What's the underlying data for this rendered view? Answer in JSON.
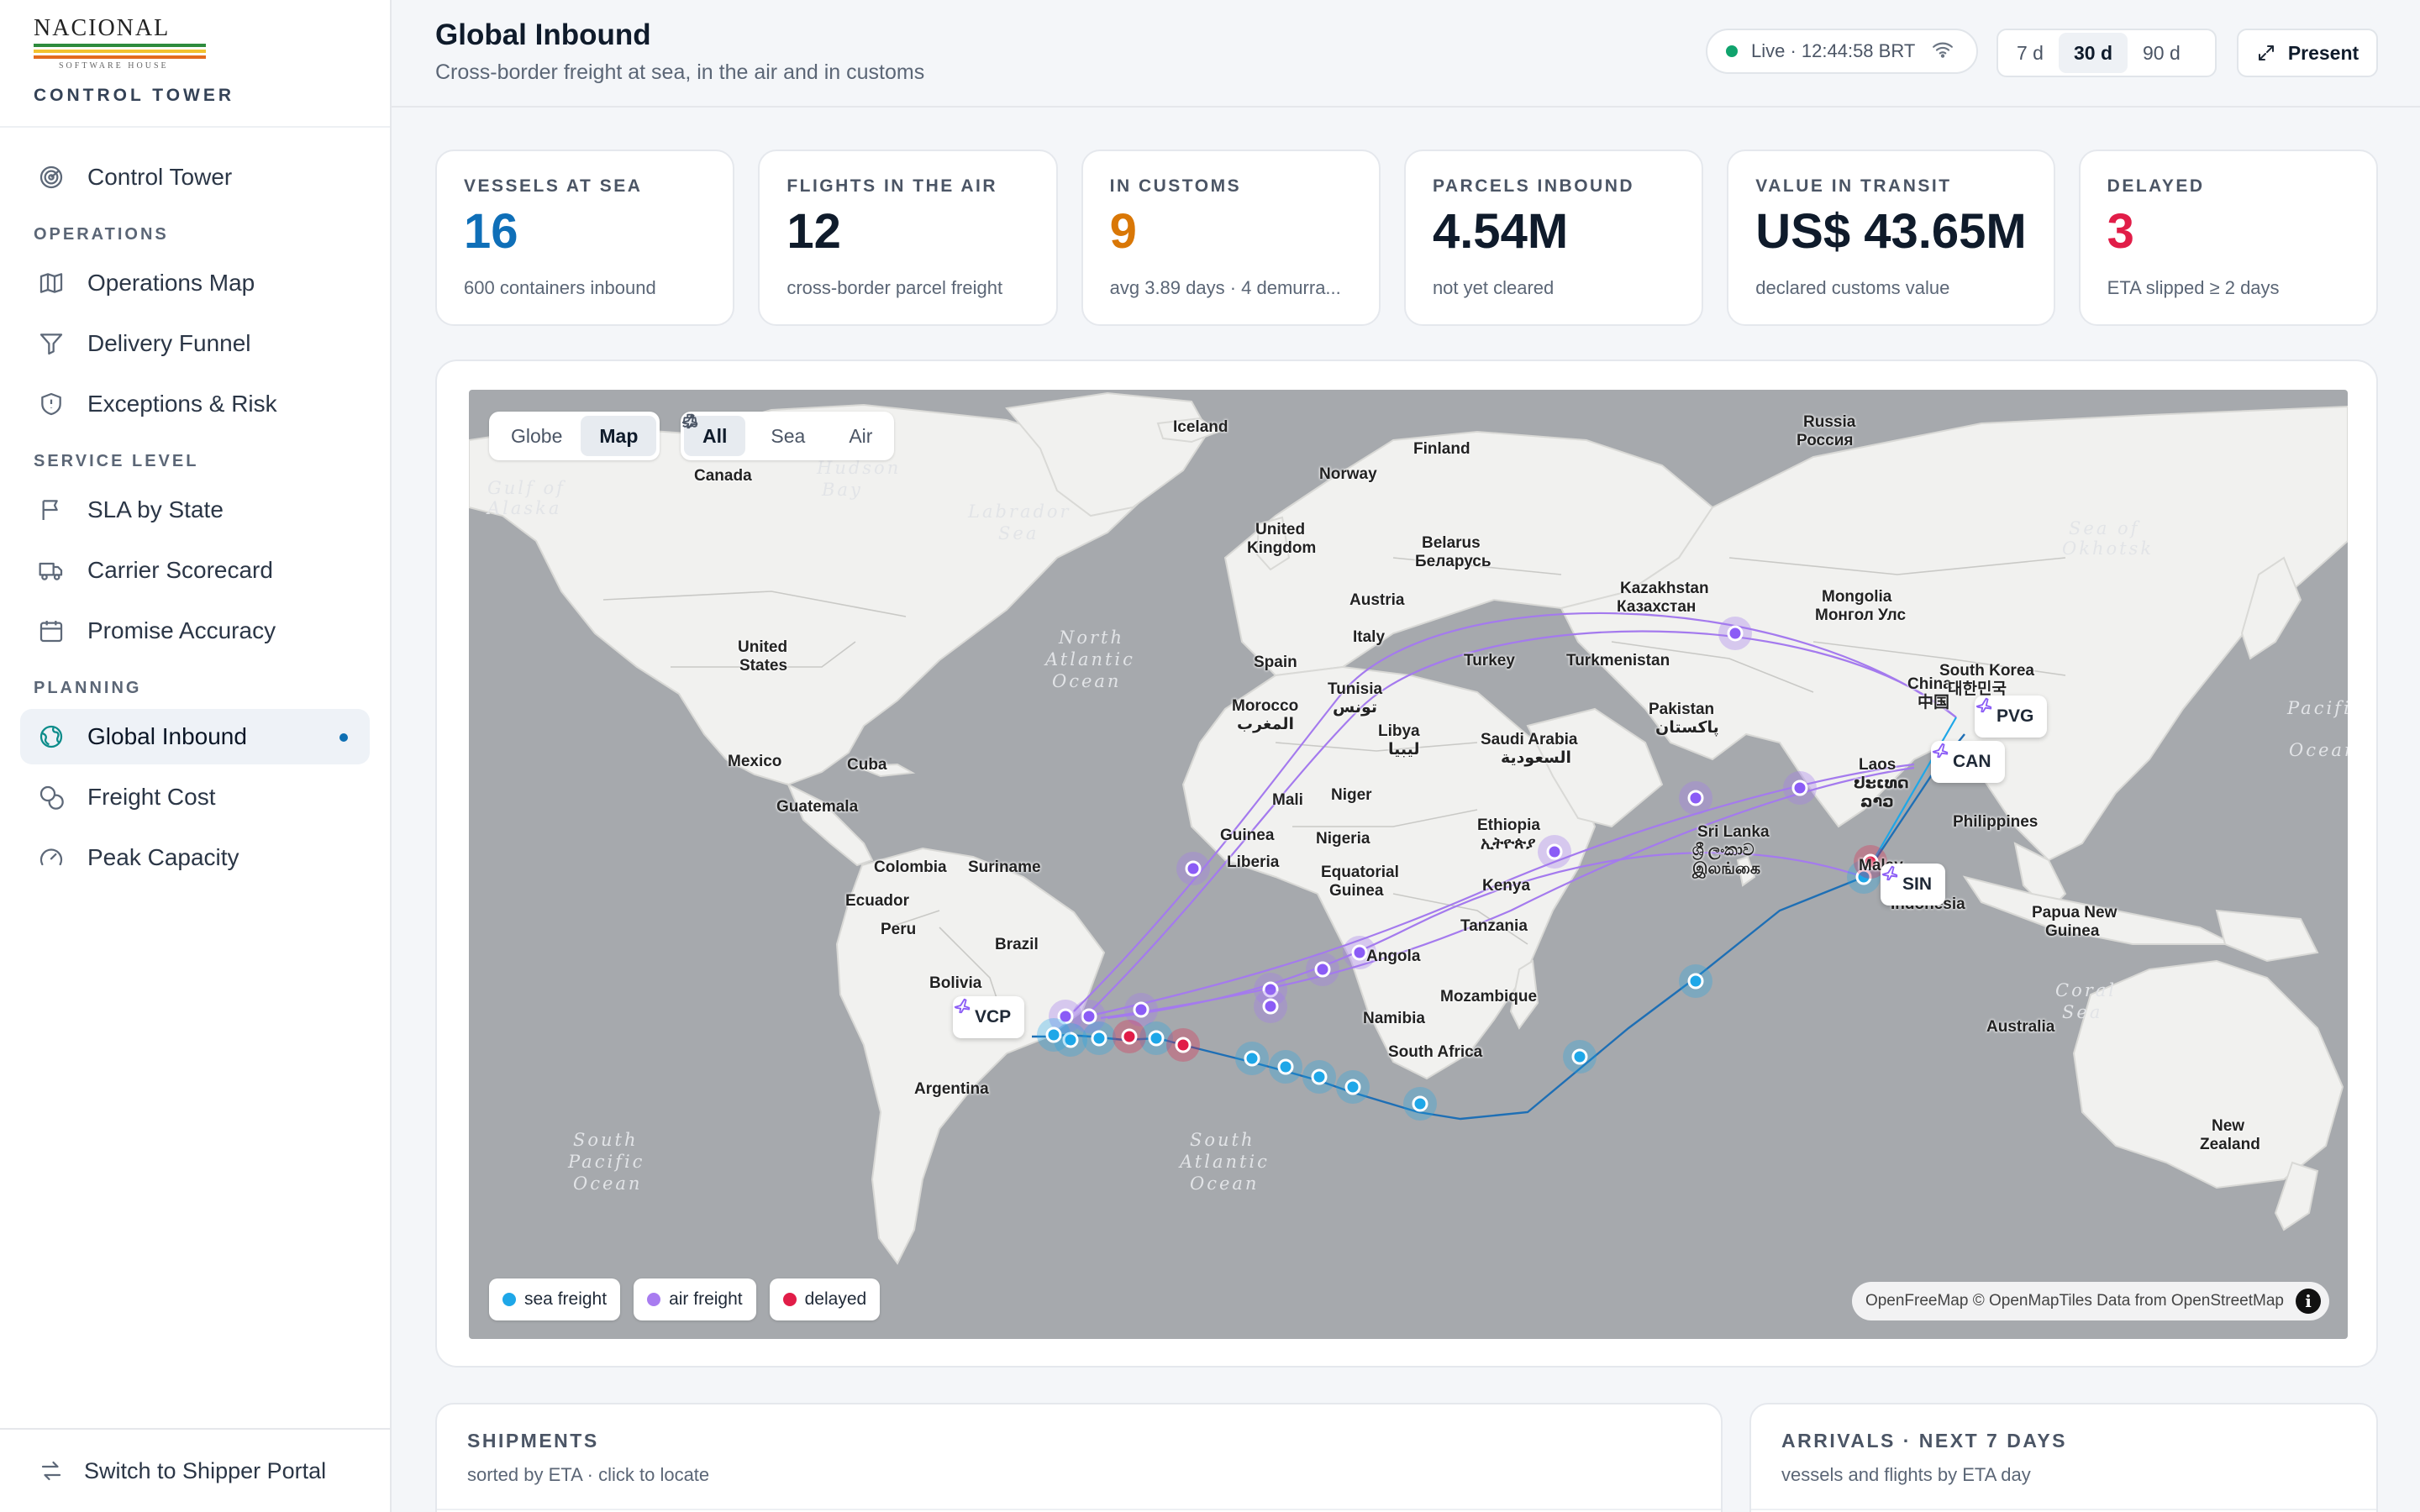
{
  "brand": {
    "name": "NACIONAL",
    "sub": "SOFTWARE HOUSE",
    "tag": "CONTROL TOWER",
    "stripe_colors": [
      "#2e8b3d",
      "#f2c230",
      "#e36b1f"
    ]
  },
  "sidebar": {
    "top_item": {
      "label": "Control Tower",
      "icon": "radar-icon"
    },
    "sections": [
      {
        "title": "OPERATIONS",
        "items": [
          {
            "label": "Operations Map",
            "icon": "map-icon"
          },
          {
            "label": "Delivery Funnel",
            "icon": "funnel-icon"
          },
          {
            "label": "Exceptions & Risk",
            "icon": "shield-icon"
          }
        ]
      },
      {
        "title": "SERVICE LEVEL",
        "items": [
          {
            "label": "SLA by State",
            "icon": "flag-icon"
          },
          {
            "label": "Carrier Scorecard",
            "icon": "truck-icon"
          },
          {
            "label": "Promise Accuracy",
            "icon": "calendar-icon"
          }
        ]
      },
      {
        "title": "PLANNING",
        "items": [
          {
            "label": "Global Inbound",
            "icon": "globe-icon",
            "active": true
          },
          {
            "label": "Freight Cost",
            "icon": "coins-icon"
          },
          {
            "label": "Peak Capacity",
            "icon": "gauge-icon"
          }
        ]
      }
    ],
    "switch_label": "Switch to Shipper Portal"
  },
  "header": {
    "title": "Global Inbound",
    "subtitle": "Cross-border freight at sea, in the air and in customs",
    "live": "Live · 12:44:58 BRT",
    "ranges": [
      "7 d",
      "30 d",
      "90 d"
    ],
    "selected_range": "30 d",
    "present_label": "Present"
  },
  "kpis": [
    {
      "label": "VESSELS AT SEA",
      "value": "16",
      "sub": "600 containers inbound",
      "color": "#0f6fb8"
    },
    {
      "label": "FLIGHTS IN THE AIR",
      "value": "12",
      "sub": "cross-border parcel freight",
      "color": "#0f1b2b"
    },
    {
      "label": "IN CUSTOMS",
      "value": "9",
      "sub": "avg 3.89 days · 4 demurra...",
      "color": "#d97706"
    },
    {
      "label": "PARCELS INBOUND",
      "value": "4.54M",
      "sub": "not yet cleared",
      "color": "#0f1b2b"
    },
    {
      "label": "VALUE IN TRANSIT",
      "value": "US$ 43.65M",
      "sub": "declared customs value",
      "color": "#0f1b2b"
    },
    {
      "label": "DELAYED",
      "value": "3",
      "sub": "ETA slipped ≥ 2 days",
      "color": "#e11d48"
    }
  ],
  "map": {
    "view_toggle": [
      "Globe",
      "Map"
    ],
    "selected_view": "Map",
    "mode_filter": [
      "All",
      "Sea",
      "Air"
    ],
    "selected_mode": "All",
    "hubs": [
      {
        "code": "VCP",
        "icon": "plane-icon"
      },
      {
        "code": "PVG",
        "icon": "plane-icon"
      },
      {
        "code": "CAN",
        "icon": "plane-icon"
      },
      {
        "code": "SIN",
        "icon": "plane-icon"
      }
    ],
    "places": [
      "Iceland",
      "Russia",
      "Россия",
      "Finland",
      "Norway",
      "Canada",
      "Gulf of",
      "Alaska",
      "Hudson",
      "Bay",
      "Labrador",
      "Sea",
      "United",
      "Kingdom",
      "Belarus",
      "Беларусь",
      "Kazakhstan",
      "Казахстан",
      "Mongolia",
      "Монгол Улс",
      "Sea of",
      "Okhotsk",
      "United",
      "States",
      "Austria",
      "Italy",
      "Turkey",
      "Turkmenistan",
      "Spain",
      "North",
      "Atlantic",
      "Ocean",
      "Tunisia",
      "تونس",
      "China",
      "中国",
      "South Korea",
      "대한민국",
      "Morocco",
      "المغرب",
      "Libya",
      "ليبيا",
      "Pakistan",
      "پاکستان",
      "Saudi Arabia",
      "السعودية",
      "Mexico",
      "Cuba",
      "Guatemala",
      "Mali",
      "Niger",
      "Laos",
      "ປະເທດ",
      "ລາວ",
      "Philippines",
      "Guinea",
      "Liberia",
      "Nigeria",
      "Ethiopia",
      "ኢትዮጵያ",
      "Sri Lanka",
      "ශ්‍රී ලංකාව",
      "இலங்கை",
      "Colombia",
      "Suriname",
      "Ecuador",
      "Equatorial",
      "Guinea",
      "Kenya",
      "Malay",
      "Indonesia",
      "Peru",
      "Brazil",
      "Tanzania",
      "Papua New",
      "Guinea",
      "Bolivia",
      "Angola",
      "Mozambique",
      "Coral",
      "Sea",
      "Australia",
      "Namibia",
      "South Africa",
      "Argentina",
      "South",
      "Pacific",
      "Ocean",
      "South",
      "Atlantic",
      "Ocean",
      "New",
      "Zealand",
      "Pacifi",
      "Ocear"
    ],
    "legend": [
      {
        "label": "sea freight",
        "color": "#1ea7e8"
      },
      {
        "label": "air freight",
        "color": "#a87cf0"
      },
      {
        "label": "delayed",
        "color": "#e11d48"
      }
    ],
    "attribution": {
      "a": "OpenFreeMap",
      "b": "© OpenMapTiles",
      "c": "Data from",
      "d": "OpenStreetMap"
    }
  },
  "shipments": {
    "title": "SHIPMENTS",
    "sub": "sorted by ETA · click to locate"
  },
  "arrivals": {
    "title": "ARRIVALS · NEXT 7 DAYS",
    "sub": "vessels and flights by ETA day"
  }
}
